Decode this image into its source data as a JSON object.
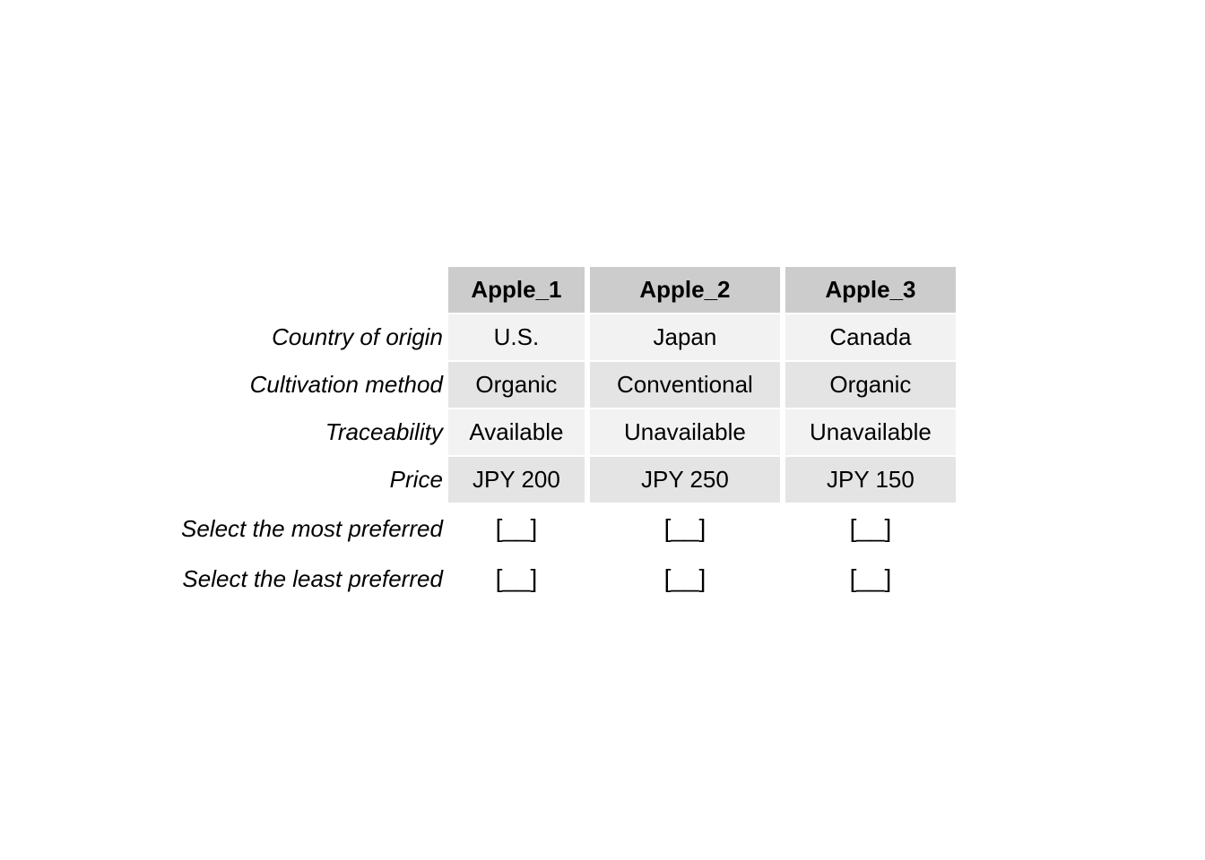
{
  "table": {
    "corner_label": "",
    "columns": [
      {
        "key": "apple_1",
        "header": "Apple_1"
      },
      {
        "key": "apple_2",
        "header": "Apple_2"
      },
      {
        "key": "apple_3",
        "header": "Apple_3"
      }
    ],
    "attribute_rows": [
      {
        "label": "Country of origin",
        "values": [
          "U.S.",
          "Japan",
          "Canada"
        ],
        "band": "light"
      },
      {
        "label": "Cultivation method",
        "values": [
          "Organic",
          "Conventional",
          "Organic"
        ],
        "band": "dark"
      },
      {
        "label": "Traceability",
        "values": [
          "Available",
          "Unavailable",
          "Unavailable"
        ],
        "band": "light"
      },
      {
        "label": "Price",
        "values": [
          "JPY 200",
          "JPY 250",
          "JPY 150"
        ],
        "band": "dark"
      }
    ],
    "selection_rows": [
      {
        "label": "Select the most preferred",
        "values": [
          "[__]",
          "[__]",
          "[__]"
        ]
      },
      {
        "label": "Select the least preferred",
        "values": [
          "[__]",
          "[__]",
          "[__]"
        ]
      }
    ]
  },
  "chart_data": {
    "type": "table",
    "title": "",
    "xlabel": "",
    "ylabel": "",
    "categories": [
      "Apple_1",
      "Apple_2",
      "Apple_3"
    ],
    "row_headers": [
      "Country of origin",
      "Cultivation method",
      "Traceability",
      "Price",
      "Select the most preferred",
      "Select the least preferred"
    ],
    "rows": [
      {
        "attribute": "Country of origin",
        "Apple_1": "U.S.",
        "Apple_2": "Japan",
        "Apple_3": "Canada"
      },
      {
        "attribute": "Cultivation method",
        "Apple_1": "Organic",
        "Apple_2": "Conventional",
        "Apple_3": "Organic"
      },
      {
        "attribute": "Traceability",
        "Apple_1": "Available",
        "Apple_2": "Unavailable",
        "Apple_3": "Unavailable"
      },
      {
        "attribute": "Price",
        "Apple_1": "JPY 200",
        "Apple_2": "JPY 250",
        "Apple_3": "JPY 150"
      },
      {
        "attribute": "Select the most preferred",
        "Apple_1": "[__]",
        "Apple_2": "[__]",
        "Apple_3": "[__]"
      },
      {
        "attribute": "Select the least preferred",
        "Apple_1": "[__]",
        "Apple_2": "[__]",
        "Apple_3": "[__]"
      }
    ],
    "prices_jpy": [
      200,
      250,
      150
    ],
    "grid": false,
    "legend": "none"
  },
  "colors": {
    "page_background": "#ffffff",
    "header_fill": "#cccccc",
    "band_light": "#f2f2f2",
    "band_dark": "#e4e4e4",
    "text": "#000000"
  }
}
